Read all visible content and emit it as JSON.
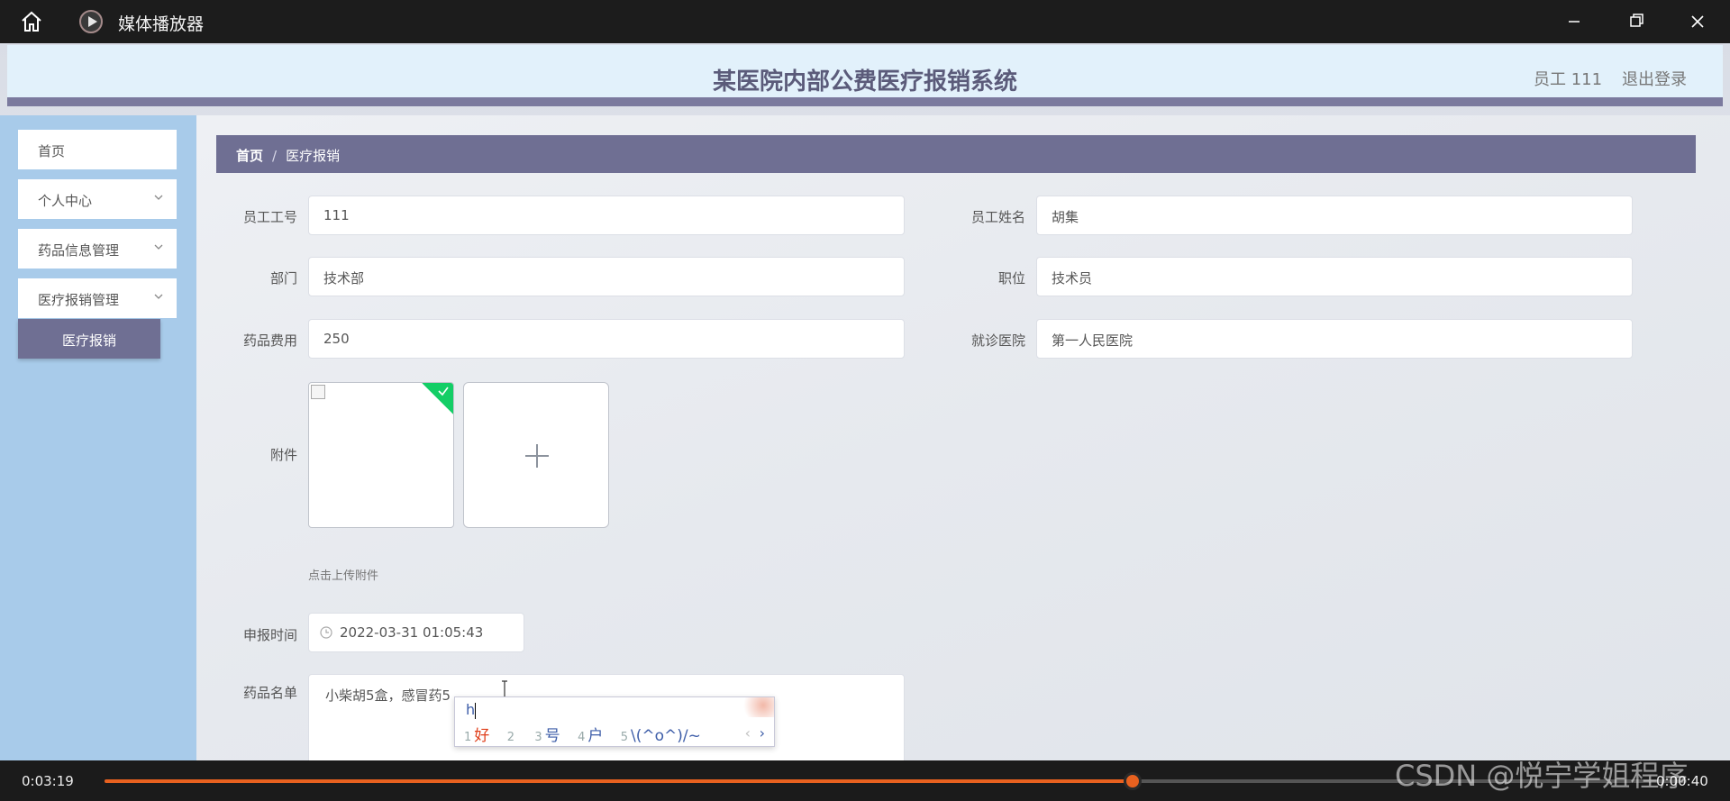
{
  "player": {
    "app_title": "媒体播放器",
    "current_time": "0:03:19",
    "total_time": "0:00:40",
    "progress_fraction": 0.65,
    "accent_color": "#e8611f"
  },
  "header": {
    "title": "某医院内部公费医疗报销系统",
    "user": "员工 111",
    "logout": "退出登录"
  },
  "sidebar": {
    "items": [
      {
        "label": "首页"
      },
      {
        "label": "个人中心"
      },
      {
        "label": "药品信息管理"
      },
      {
        "label": "医疗报销管理"
      }
    ],
    "active_sub": "医疗报销"
  },
  "breadcrumb": {
    "home": "首页",
    "separator": "/",
    "current": "医疗报销"
  },
  "form": {
    "employee_id": {
      "label": "员工工号",
      "value": "111"
    },
    "employee_name": {
      "label": "员工姓名",
      "value": "胡集"
    },
    "department": {
      "label": "部门",
      "value": "技术部"
    },
    "position": {
      "label": "职位",
      "value": "技术员"
    },
    "drug_cost": {
      "label": "药品费用",
      "value": "250"
    },
    "hospital": {
      "label": "就诊医院",
      "value": "第一人民医院"
    },
    "attachment": {
      "label": "附件",
      "hint": "点击上传附件"
    },
    "report_time": {
      "label": "申报时间",
      "value": "2022-03-31 01:05:43"
    },
    "drug_list": {
      "label": "药品名单",
      "value": "小柴胡5盒，感冒药5"
    }
  },
  "ime": {
    "composition": "h",
    "candidates": [
      {
        "n": "1",
        "text": "好"
      },
      {
        "n": "2",
        "text": ""
      },
      {
        "n": "3",
        "text": "号"
      },
      {
        "n": "4",
        "text": "户"
      },
      {
        "n": "5",
        "text": "\\(^o^)/~"
      }
    ],
    "prev": "‹",
    "next": "›"
  },
  "watermark": "CSDN @悦宁学姐程序"
}
